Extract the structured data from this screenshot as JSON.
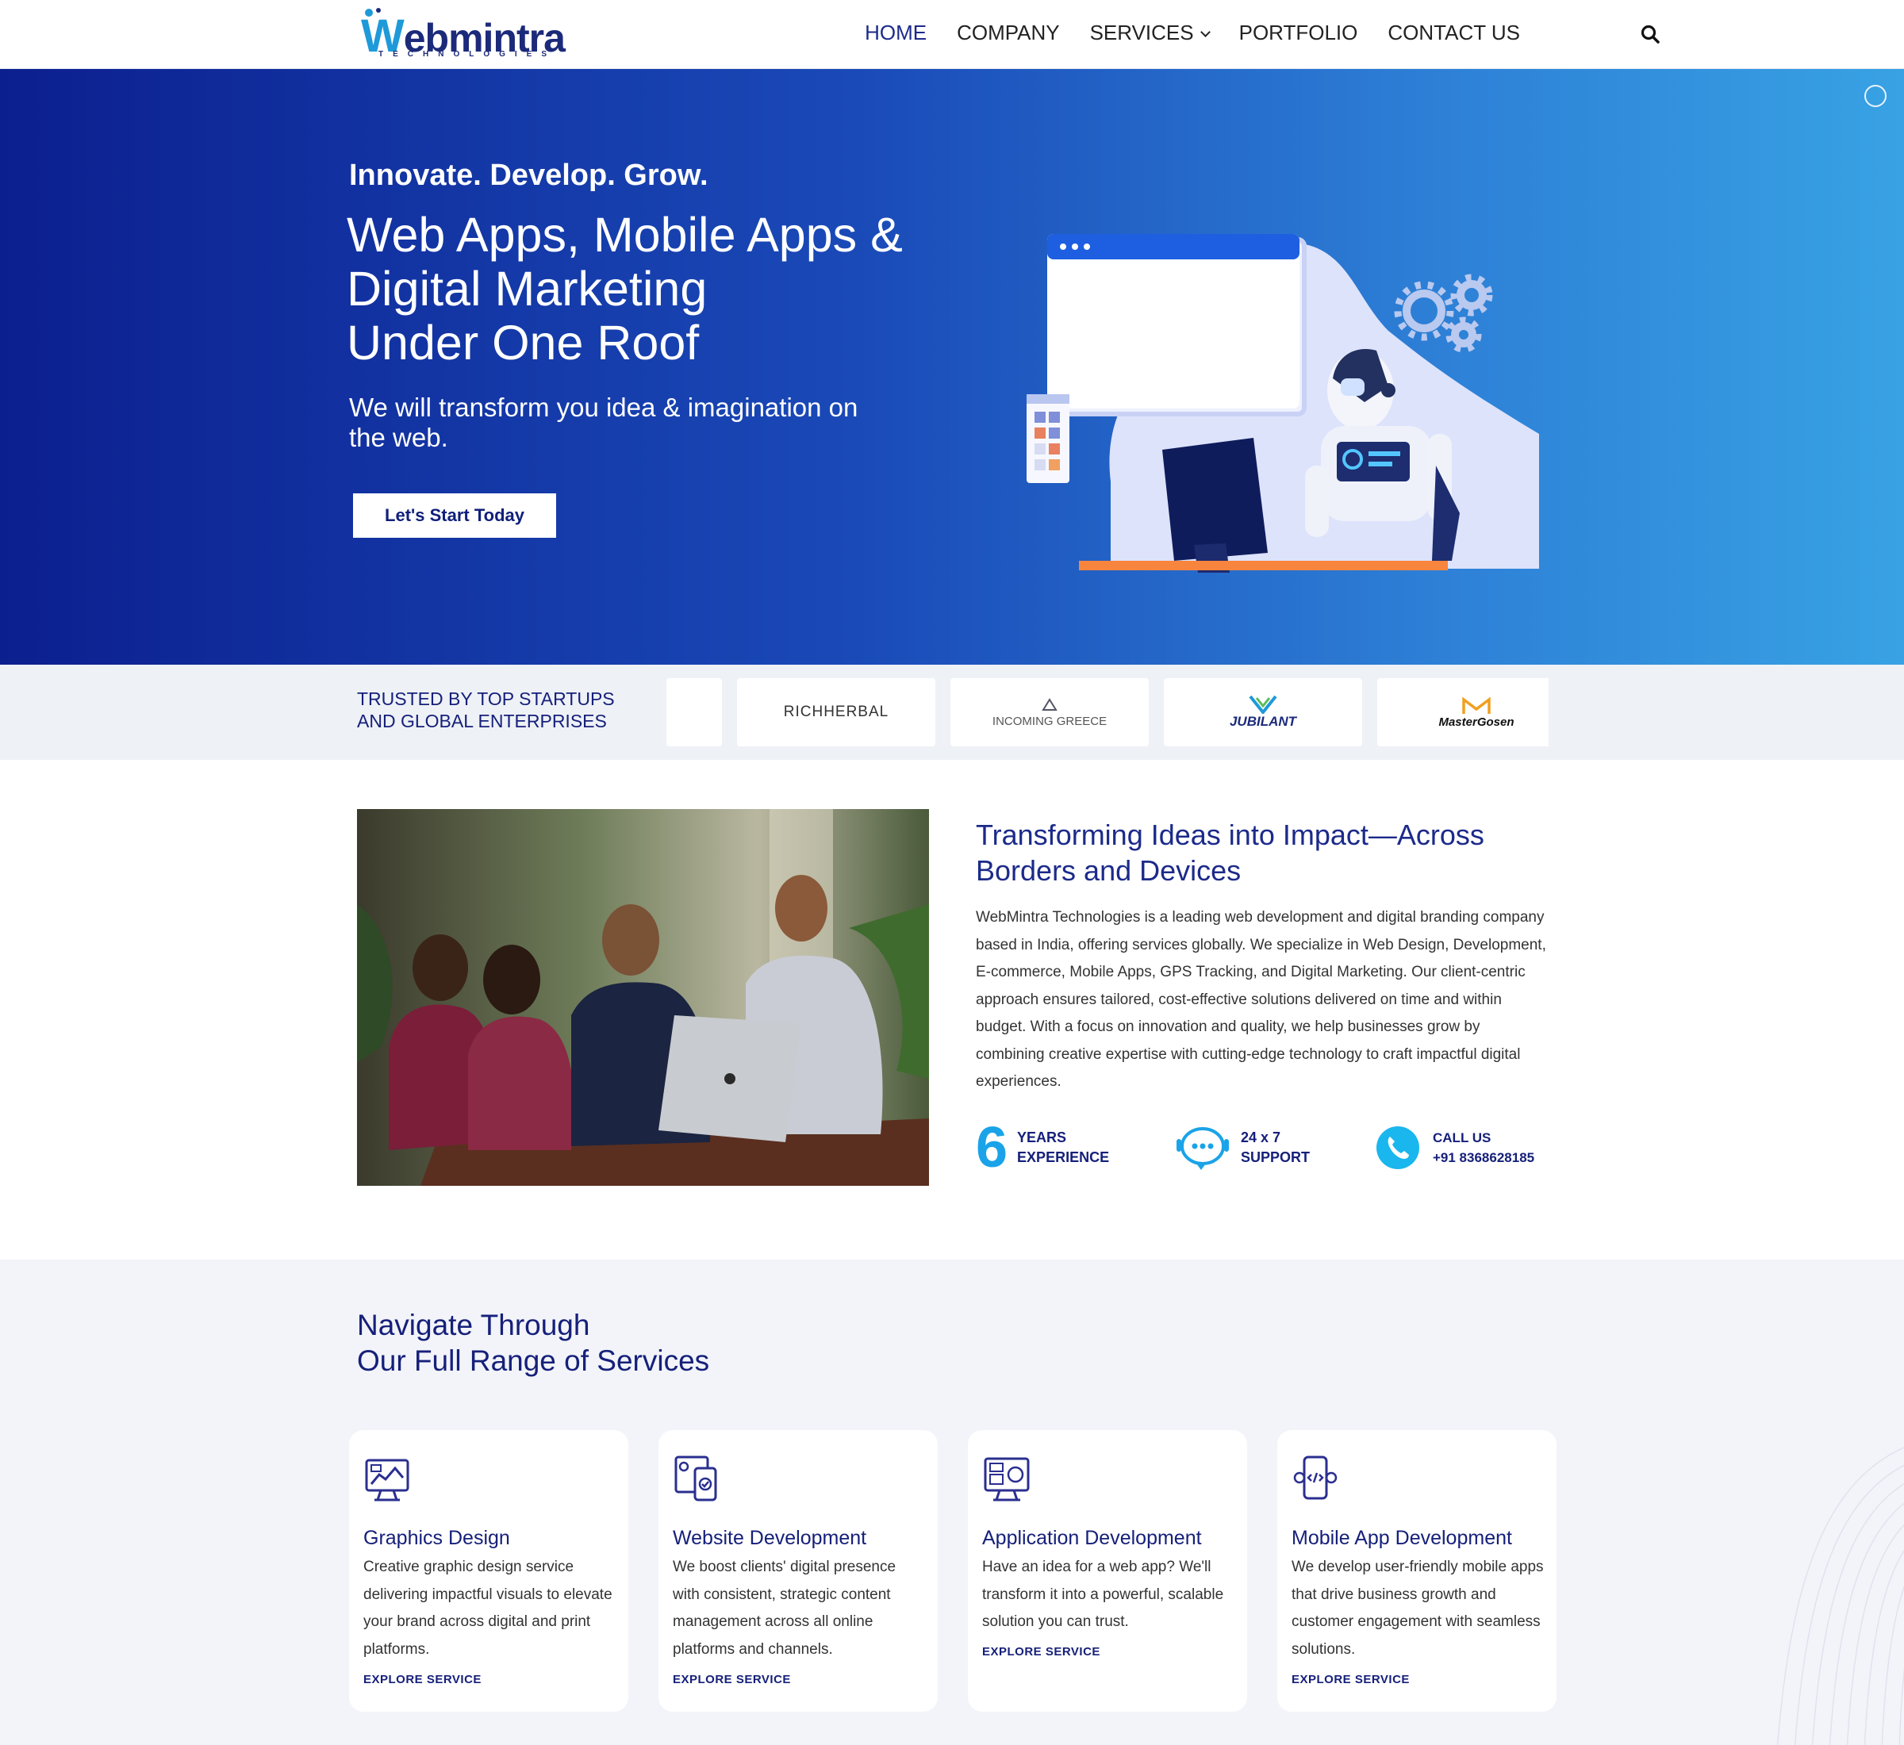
{
  "nav": {
    "logo_text_first": "W",
    "logo_text_rest": "ebmintra",
    "logo_sub": "TECHNOLOGIES",
    "items": [
      {
        "label": "HOME",
        "active": true
      },
      {
        "label": "COMPANY"
      },
      {
        "label": "SERVICES",
        "has_dropdown": true
      },
      {
        "label": "PORTFOLIO"
      },
      {
        "label": "CONTACT US"
      }
    ],
    "search_icon": "search-icon"
  },
  "hero": {
    "tagline": "Innovate. Develop. Grow.",
    "title_line1": "Web Apps, Mobile Apps &",
    "title_line2": "Digital Marketing",
    "title_line3": "Under One Roof",
    "subtitle": "We will transform you idea & imagination on the web.",
    "cta": "Let's Start Today",
    "gradient": [
      "#0c1f8f",
      "#38a2e4"
    ]
  },
  "trusted": {
    "label_line1": "TRUSTED BY TOP STARTUPS",
    "label_line2": "AND GLOBAL ENTERPRISES",
    "logos": [
      "RICHHERBAL",
      "INCOMING GREECE",
      "JUBILANT",
      "MasterGosen"
    ]
  },
  "about": {
    "title": "Transforming Ideas into Impact—Across Borders and Devices",
    "text": "WebMintra Technologies is a leading web development and digital branding company based in India, offering services globally. We specialize in Web Design, Development, E-commerce, Mobile Apps, GPS Tracking, and Digital Marketing. Our client-centric approach ensures tailored, cost-effective solutions delivered on time and within budget. With a focus on innovation and quality, we help businesses grow by combining creative expertise with cutting-edge technology to craft impactful digital experiences.",
    "stats": {
      "years_number": "6",
      "years_l1": "YEARS",
      "years_l2": "EXPERIENCE",
      "support_l1": "24 x 7",
      "support_l2": "SUPPORT",
      "call_l1": "CALL US",
      "call_l2": "+91 8368628185"
    }
  },
  "services": {
    "title_line1": "Navigate Through",
    "title_line2": "Our Full Range of Services",
    "cards": [
      {
        "title": "Graphics Design",
        "desc": "Creative graphic design service delivering impactful visuals to elevate your brand across digital and print platforms.",
        "link": "EXPLORE SERVICE",
        "icon": "graphics-design-icon"
      },
      {
        "title": "Website Development",
        "desc": "We boost clients' digital presence with consistent, strategic content management across all online platforms and channels.",
        "link": "EXPLORE SERVICE",
        "icon": "website-development-icon"
      },
      {
        "title": "Application Development",
        "desc": "Have an idea for a web app? We'll transform it into a powerful, scalable solution you can trust.",
        "link": "EXPLORE SERVICE",
        "icon": "application-development-icon"
      },
      {
        "title": "Mobile App Development",
        "desc": "We develop user-friendly mobile apps that drive business growth and customer engagement with seamless solutions.",
        "link": "EXPLORE SERVICE",
        "icon": "mobile-app-icon"
      }
    ]
  }
}
